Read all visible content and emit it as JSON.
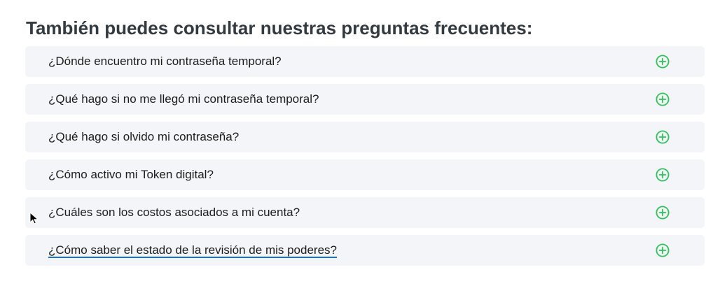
{
  "faq": {
    "title": "También puedes consultar nuestras preguntas frecuentes:",
    "items": [
      {
        "question": "¿Dónde encuentro mi contraseña temporal?",
        "icon": "plus-circle-icon"
      },
      {
        "question": "¿Qué hago si no me llegó mi contraseña temporal?",
        "icon": "plus-circle-icon"
      },
      {
        "question": "¿Qué hago si olvido mi contraseña?",
        "icon": "plus-circle-icon"
      },
      {
        "question": "¿Cómo activo mi Token digital?",
        "icon": "plus-circle-icon"
      },
      {
        "question": "¿Cuáles son los costos asociados a mi cuenta?",
        "icon": "plus-circle-icon"
      },
      {
        "question": "¿Cómo saber el estado de la revisión de mis poderes?",
        "icon": "plus-circle-icon"
      }
    ]
  },
  "colors": {
    "title": "#333a40",
    "item_background": "#f3f5f9",
    "question_text": "#1c1c1c",
    "accent_green": "#2fc25b",
    "link_underline": "#1a73c8"
  },
  "pointer": {
    "icon": "mouse-pointer-icon"
  }
}
